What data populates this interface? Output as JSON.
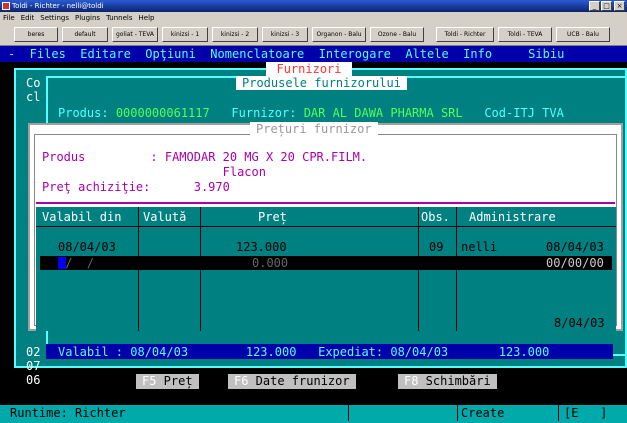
{
  "window": {
    "title": "Toldi - Richter   - nelli@toldi",
    "controls": {
      "minimize": "_",
      "maximize": "□",
      "close": "×"
    }
  },
  "menubar": [
    "File",
    "Edit",
    "Settings",
    "Plugins",
    "Tunnels",
    "Help"
  ],
  "toolbar": [
    "beres",
    "default",
    "goliat - TEVA",
    "kinizsi - 1",
    "kinizsi - 2",
    "kinizsi - 3",
    "Organon - Balu",
    "Ozone - Balu",
    "Toldi - Richter",
    "Toldi - TEVA",
    "UCB - Balu"
  ],
  "terminal_menu": "-  Files  Editare  Opţiuni  Nomenclatoare  Interogare  Altele  Info     Sibiu",
  "background": {
    "title": "Furnizori",
    "left_text": "Co\ncl",
    "left_numbers": "02\n07\n06"
  },
  "product_window": {
    "title": "Produsele furnizorului",
    "produs_label": "Produs:",
    "produs_code": "0000000061117",
    "furnizor_label": "Furnizor:",
    "furnizor_name": "DAR AL DAWA PHARMA SRL",
    "cod_label": "Cod-ITJ TVA"
  },
  "preturi": {
    "title": "Prețuri furnizor",
    "produs_label": "Produs",
    "produs_value": ": FAMODAR 20 MG X 20 CPR.FILM.",
    "produs_form": "Flacon",
    "pret_label": "Preţ achiziţie:",
    "pret_value": "3.970",
    "headers": {
      "valabil": "Valabil din",
      "valuta": "Valută",
      "pret": "Preț",
      "obs": "Obs.",
      "admin": "Administrare"
    },
    "row1": {
      "valabil": "08/04/03",
      "pret": "123.000",
      "obs": "09",
      "user": "nelli",
      "date": "08/04/03"
    },
    "row2": {
      "valabil": " /  /  ",
      "pret": "0.000",
      "date": "00/00/00"
    },
    "footer_date": "8/04/03"
  },
  "status_row": {
    "valabil": "Valabil : 08/04/03",
    "pret": "123.000",
    "expediat": "Expediat: 08/04/03",
    "total": "123.000"
  },
  "fkeys": [
    {
      "key": "F5",
      "label": " Preț"
    },
    {
      "key": "F6",
      "label": " Date frunizor"
    },
    {
      "key": "F8",
      "label": " Schimbări"
    }
  ],
  "statusbar": {
    "runtime": "Runtime: Richter",
    "create": "Create",
    "mode": "[E   ]"
  }
}
